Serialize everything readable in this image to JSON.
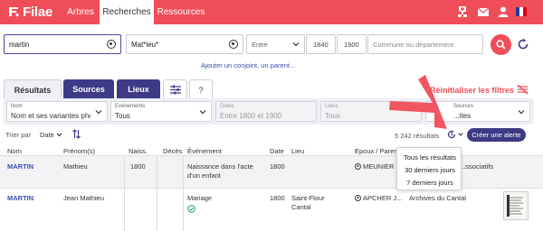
{
  "brand": {
    "name": "Filae",
    "color": "#ef4d58",
    "accent": "#3d3b85"
  },
  "nav": {
    "tabs": [
      {
        "label": "Arbres",
        "active": false
      },
      {
        "label": "Recherches",
        "active": true
      },
      {
        "label": "Ressources",
        "active": false
      }
    ],
    "icons": [
      "add-tree-icon",
      "mail-icon",
      "user-icon",
      "french-flag-icon"
    ]
  },
  "search": {
    "surname_value": "martin",
    "firstname_value": "Mat*ieu*",
    "period_select": "Entre",
    "year_from": "1840",
    "year_to": "1900",
    "location_placeholder": "Commune ou département",
    "add_spouse_link": "Ajouter un conjoint, un parent..."
  },
  "tabs": {
    "results": "Résultats",
    "sources": "Sources",
    "places": "Lieux",
    "help": "?"
  },
  "reset_filters": "Réinitialiser les filtres",
  "filters": [
    {
      "label": "Nom",
      "value": "Nom et ses variantes pho...",
      "disabled": false
    },
    {
      "label": "Evénements",
      "value": "Tous",
      "disabled": false
    },
    {
      "label": "Dates",
      "value": "Entre 1800 et 1900",
      "disabled": true
    },
    {
      "label": "Lieux",
      "value": "Tous",
      "disabled": true
    },
    {
      "label": "Sources",
      "value": "...ites",
      "disabled": false
    }
  ],
  "sort": {
    "label": "Trier par",
    "value": "Date"
  },
  "results_count": "5 242 résultats",
  "create_alert": "Créer une alerte",
  "history_dropdown": {
    "items": [
      "Tous les résultats",
      "30 derniers jours",
      "7 derniers jours"
    ]
  },
  "table": {
    "headers": [
      "Nom",
      "Prénom(s)",
      "Naiss.",
      "Décès",
      "Événement",
      "Date",
      "Lieu",
      "Epoux / Parents"
    ],
    "rows": [
      {
        "name": "MARTIN",
        "firstname": "Mathieu",
        "birth": "1800",
        "death": "",
        "event_line1": "Naissance dans l'acte",
        "event_line2": "d'un enfant",
        "date": "1800",
        "place": "",
        "owner": "MEUNIER L...",
        "source": "...ssociatifs"
      },
      {
        "name": "MARTIN",
        "firstname": "Jean Mathieu",
        "birth": "",
        "death": "",
        "event_line1": "Mariage",
        "event_line2": "",
        "date": "1800",
        "place_line1": "Saint-Flour",
        "place_line2": "Cantal",
        "owner": "APCHER J...",
        "source": "Archives du Cantal"
      }
    ]
  }
}
